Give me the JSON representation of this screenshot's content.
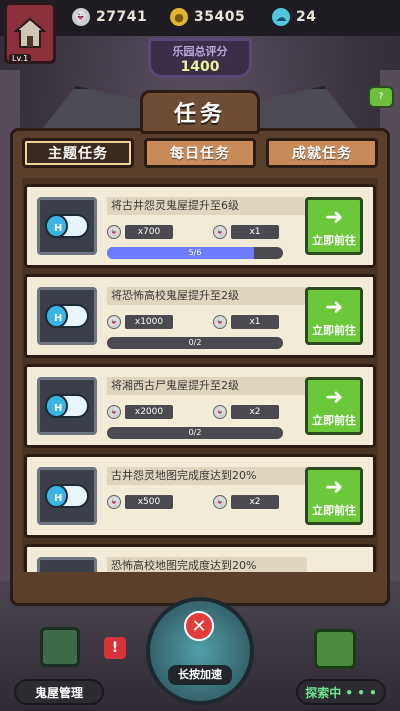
{
  "topbar": {
    "level": "Lv.1",
    "ghost_count": "27741",
    "coin_count": "35405",
    "soul_count": "24",
    "icons": [
      "ghost-icon",
      "coin-icon",
      "soul-icon"
    ]
  },
  "score": {
    "label": "乐园总评分",
    "value": "1400"
  },
  "modal": {
    "title": "任务",
    "tabs": [
      {
        "label": "主题任务",
        "active": true
      },
      {
        "label": "每日任务",
        "active": false
      },
      {
        "label": "成就任务",
        "active": false
      }
    ],
    "go_label": "立即前往",
    "tasks": [
      {
        "name": "将古井怨灵鬼屋提升至6级",
        "reward1": "x700",
        "reward2": "x1",
        "progress_text": "5/6",
        "progress": 0.833
      },
      {
        "name": "将恐怖高校鬼屋提升至2级",
        "reward1": "x1000",
        "reward2": "x1",
        "progress_text": "0/2",
        "progress": 0
      },
      {
        "name": "将湘西古尸鬼屋提升至2级",
        "reward1": "x2000",
        "reward2": "x2",
        "progress_text": "0/2",
        "progress": 0
      },
      {
        "name": "古井怨灵地图完成度达到20%",
        "reward1": "x500",
        "reward2": "x2",
        "progress_text": "",
        "progress": 0
      },
      {
        "name": "恐怖高校地图完成度达到20%",
        "reward1": "",
        "reward2": "",
        "progress_text": "",
        "progress": 0
      }
    ]
  },
  "bottom": {
    "left_label": "鬼屋管理",
    "center_label": "长按加速",
    "right_label": "探索中 • • •",
    "alert_text": "!"
  },
  "colors": {
    "accent_green": "#6bc83a",
    "progress_blue": "#6c7cff",
    "modal_brown": "#5a3f2d",
    "card_bg": "#f1ebd7"
  }
}
